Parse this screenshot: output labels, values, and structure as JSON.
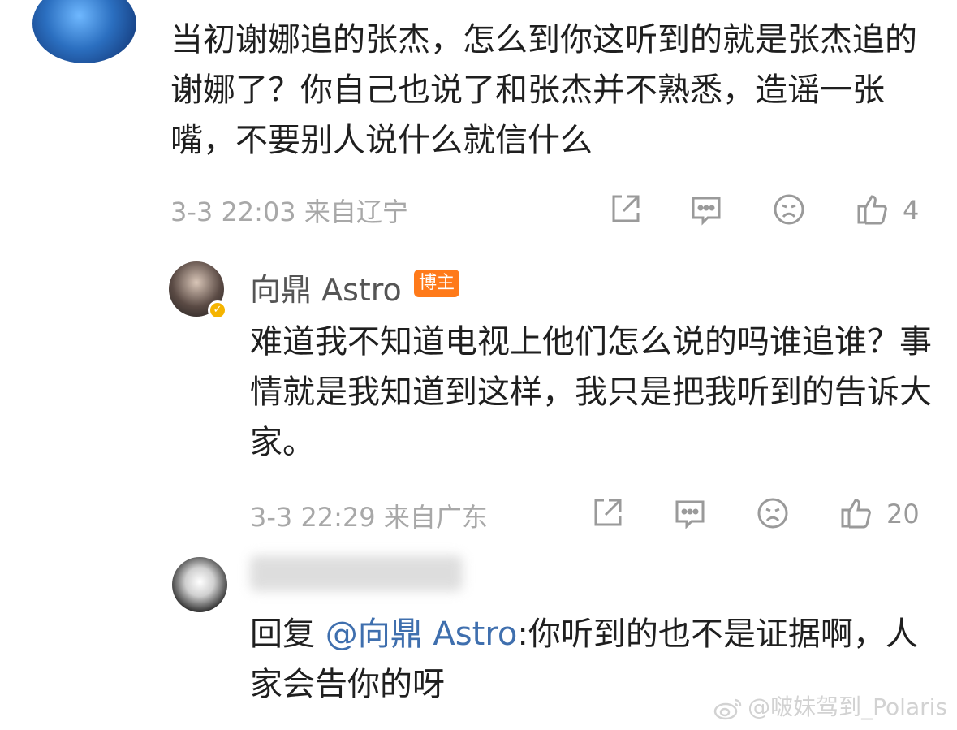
{
  "comments": [
    {
      "text": "当初谢娜追的张杰，怎么到你这听到的就是张杰追的谢娜了？你自己也说了和张杰并不熟悉，造谣一张嘴，不要别人说什么就信什么",
      "time": "3-3 22:03",
      "location": "来自辽宁",
      "likes": "4"
    }
  ],
  "replies": [
    {
      "name": "向鼎 Astro",
      "badge": "博主",
      "text": "难道我不知道电视上他们怎么说的吗谁追谁？事情就是我知道到这样，我只是把我听到的告诉大家。",
      "time": "3-3 22:29",
      "location": "来自广东",
      "likes": "20"
    },
    {
      "reply_prefix": "回复 ",
      "mention": "@向鼎 Astro",
      "text": ":你听到的也不是证据啊，人家会告你的呀"
    }
  ],
  "watermark": "@啵妹驾到_Polaris",
  "icons": {
    "share": "share-icon",
    "comment": "comment-icon",
    "dislike": "sad-face-icon",
    "like": "thumbs-up-icon",
    "verified": "verified-badge-icon",
    "weibo": "weibo-logo-icon"
  },
  "colors": {
    "badge_bg": "#ff7a1a",
    "mention": "#3f6fae",
    "meta_gray": "#a8a8a8"
  }
}
